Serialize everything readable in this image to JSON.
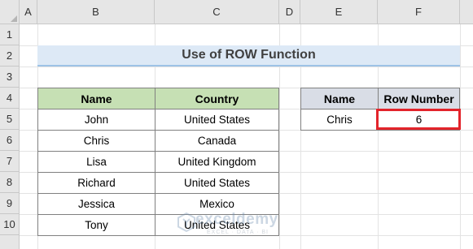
{
  "spreadsheet": {
    "columns": [
      "A",
      "B",
      "C",
      "D",
      "E",
      "F"
    ],
    "rows": [
      "1",
      "2",
      "3",
      "4",
      "5",
      "6",
      "7",
      "8",
      "9",
      "10"
    ]
  },
  "title": "Use of ROW Function",
  "main_table": {
    "headers": [
      "Name",
      "Country"
    ],
    "rows": [
      [
        "John",
        "United States"
      ],
      [
        "Chris",
        "Canada"
      ],
      [
        "Lisa",
        "United Kingdom"
      ],
      [
        "Richard",
        "United States"
      ],
      [
        "Jessica",
        "Mexico"
      ],
      [
        "Tony",
        "United States"
      ]
    ]
  },
  "result_table": {
    "headers": [
      "Name",
      "Row Number"
    ],
    "row": [
      "Chris",
      "6"
    ]
  },
  "colors": {
    "title_bg": "#dde9f6",
    "main_header_bg": "#c6e0b4",
    "result_header_bg": "#d9dde6",
    "highlight_border": "#e3242b"
  },
  "watermark": {
    "name": "exceldemy",
    "tagline": "EXCEL · DATA · BI"
  }
}
